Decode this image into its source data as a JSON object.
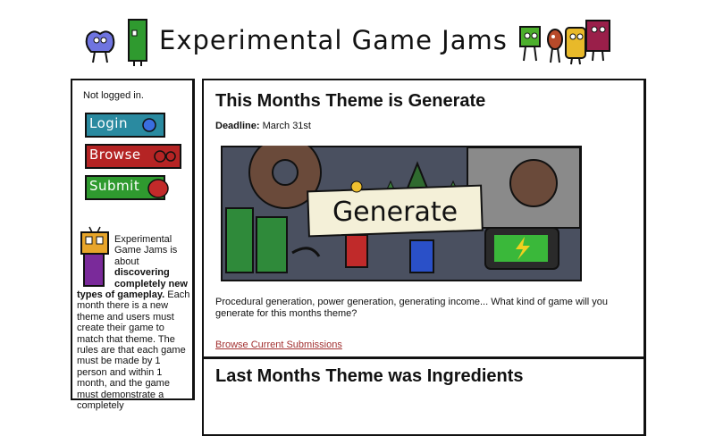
{
  "header": {
    "title": "Experimental Game Jams",
    "logo_icon": "doodle-characters-icon"
  },
  "sidebar": {
    "status": "Not logged in.",
    "buttons": [
      {
        "label": "Login",
        "color": "#2a8aa0",
        "icon": "blue-bird-icon"
      },
      {
        "label": "Browse",
        "color": "#b52424",
        "icon": "red-circles-icon"
      },
      {
        "label": "Submit",
        "color": "#2f9a2f",
        "icon": "red-blob-icon"
      }
    ],
    "about": {
      "intro": "Experimental Game Jams is about ",
      "emphasis": "discovering completely new types of gameplay.",
      "rest": " Each month there is a new theme and users must create their game to match that theme. The rules are that each game must be made by 1 person and within 1 month, and the game must demonstrate a completely"
    }
  },
  "main": {
    "current": {
      "title": "This Months Theme is Generate",
      "deadline_label": "Deadline:",
      "deadline_value": " March 31st",
      "banner_text": "Generate",
      "description": "Procedural generation, power generation, generating income... What kind of game will you generate for this months theme?",
      "browse_link": "Browse Current Submissions"
    },
    "previous": {
      "title": "Last Months Theme was Ingredients"
    }
  },
  "colors": {
    "link": "#a23030",
    "border": "#111111"
  }
}
